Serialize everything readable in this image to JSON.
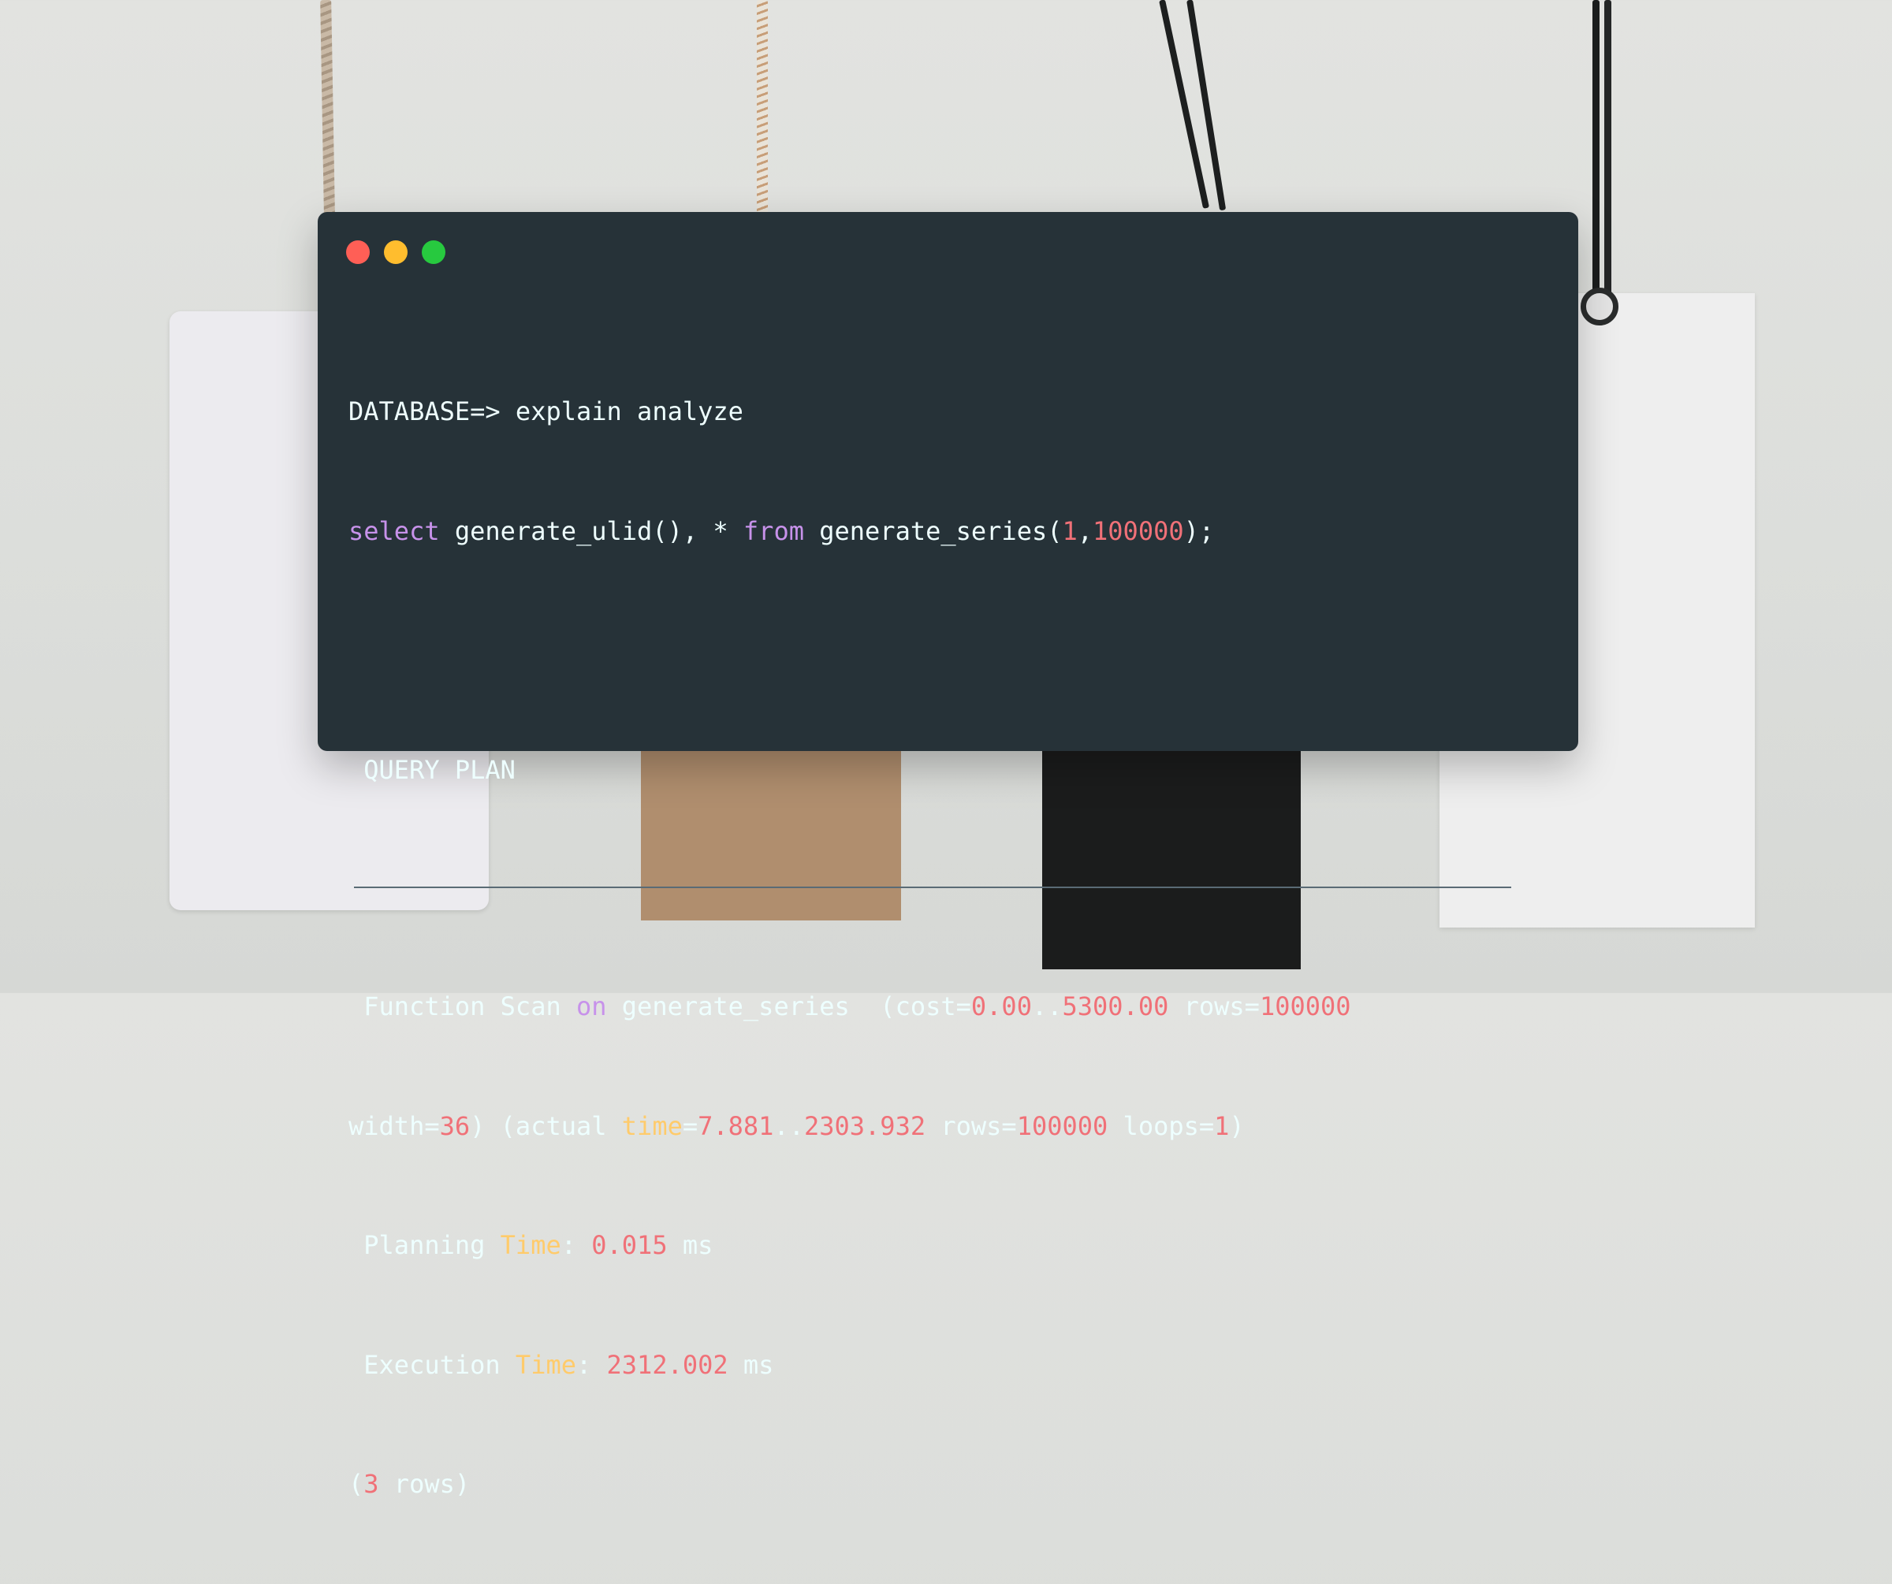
{
  "window": {
    "buttons": [
      {
        "name": "close",
        "color": "#ff5f56"
      },
      {
        "name": "minimize",
        "color": "#ffbd2e"
      },
      {
        "name": "maximize",
        "color": "#27c93f"
      }
    ]
  },
  "terminal": {
    "line1": {
      "prompt": "DATABASE=> explain analyze"
    },
    "line2": {
      "kw_select": "select",
      "t1": " generate_ulid(), * ",
      "kw_from": "from",
      "t2": " generate_series(",
      "n1": "1",
      "comma": ",",
      "n2": "100000",
      "t3": ");"
    },
    "header": " QUERY PLAN",
    "plan1": {
      "t1": " Function Scan ",
      "kw_on": "on",
      "t2": " generate_series  (cost=",
      "n1": "0.00",
      "dots": "..",
      "n2": "5300.00",
      "t3": " rows=",
      "n3": "100000"
    },
    "plan2": {
      "t1": "width=",
      "n1": "36",
      "t2": ") (actual ",
      "a1": "time",
      "t3": "=",
      "n2": "7.881",
      "dots": "..",
      "n3": "2303.932",
      "t4": " rows=",
      "n4": "100000",
      "t5": " loops=",
      "n5": "1",
      "t6": ")"
    },
    "planning": {
      "t1": " Planning ",
      "a1": "Time",
      "t2": ": ",
      "n1": "0.015",
      "t3": " ms"
    },
    "execution": {
      "t1": " Execution ",
      "a1": "Time",
      "t2": ": ",
      "n1": "2312.002",
      "t3": " ms"
    },
    "footer": {
      "t1": "(",
      "n1": "3",
      "t2": " rows)"
    }
  },
  "colors": {
    "terminal_bg": "#263238",
    "text": "#eeffff",
    "keyword": "#c792ea",
    "number": "#f07178",
    "attribute": "#ffcb6b"
  }
}
